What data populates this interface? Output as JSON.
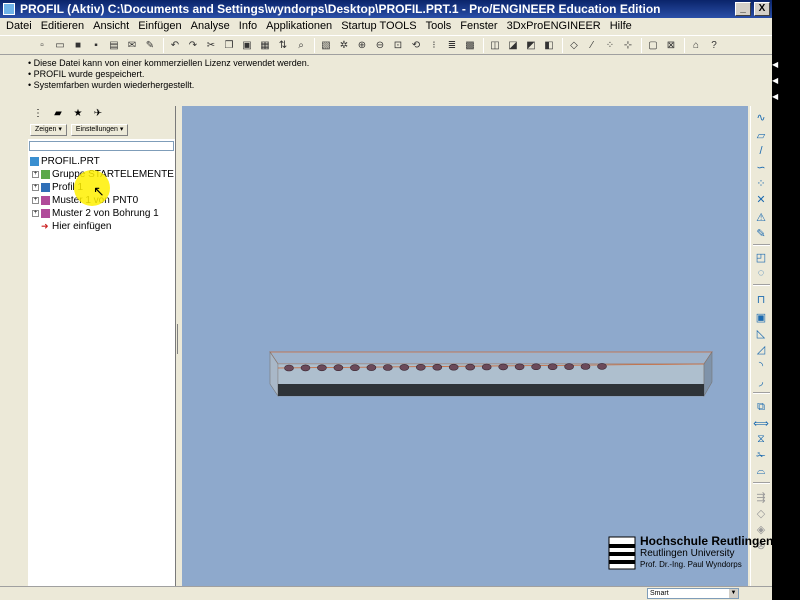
{
  "window": {
    "title": "PROFIL (Aktiv) C:\\Documents and Settings\\wyndorps\\Desktop\\PROFIL.PRT.1 - Pro/ENGINEER Education Edition",
    "minimize": "_",
    "close": "X"
  },
  "menu": [
    "Datei",
    "Editieren",
    "Ansicht",
    "Einfügen",
    "Analyse",
    "Info",
    "Applikationen",
    "Startup TOOLS",
    "Tools",
    "Fenster",
    "3DxProENGINEER",
    "Hilfe"
  ],
  "messages": [
    "• Diese Datei kann von einer kommerziellen Lizenz verwendet werden.",
    "• PROFIL wurde gespeichert.",
    "• Systemfarben wurden wiederhergestellt."
  ],
  "navigator": {
    "show_label": "Zeigen ▾",
    "settings_label": "Einstellungen ▾",
    "tree": [
      {
        "label": "PROFIL.PRT",
        "level": 0,
        "expandable": false,
        "icon": "part-icon"
      },
      {
        "label": "Gruppe STARTELEMENTE",
        "level": 1,
        "expandable": true,
        "icon": "group-icon"
      },
      {
        "label": "Profil 1",
        "level": 1,
        "expandable": true,
        "icon": "extrude-icon"
      },
      {
        "label": "Muster 1 von PNT0",
        "level": 1,
        "expandable": true,
        "icon": "pattern-icon"
      },
      {
        "label": "Muster 2 von Bohrung 1",
        "level": 1,
        "expandable": true,
        "icon": "pattern-icon"
      },
      {
        "label": "Hier einfügen",
        "level": 1,
        "expandable": false,
        "icon": "insert-here-icon"
      }
    ]
  },
  "model": {
    "hole_count": 20
  },
  "status": {
    "filter_value": "Smart"
  },
  "logo": {
    "name": "Hochschule Reutlingen",
    "english": "Reutlingen University",
    "author": "Prof. Dr.-Ing. Paul Wyndorps"
  },
  "colors": {
    "viewport_bg": "#8ea9cc",
    "title_bar": "#0a246a",
    "cursor_highlight": "#fff000"
  }
}
